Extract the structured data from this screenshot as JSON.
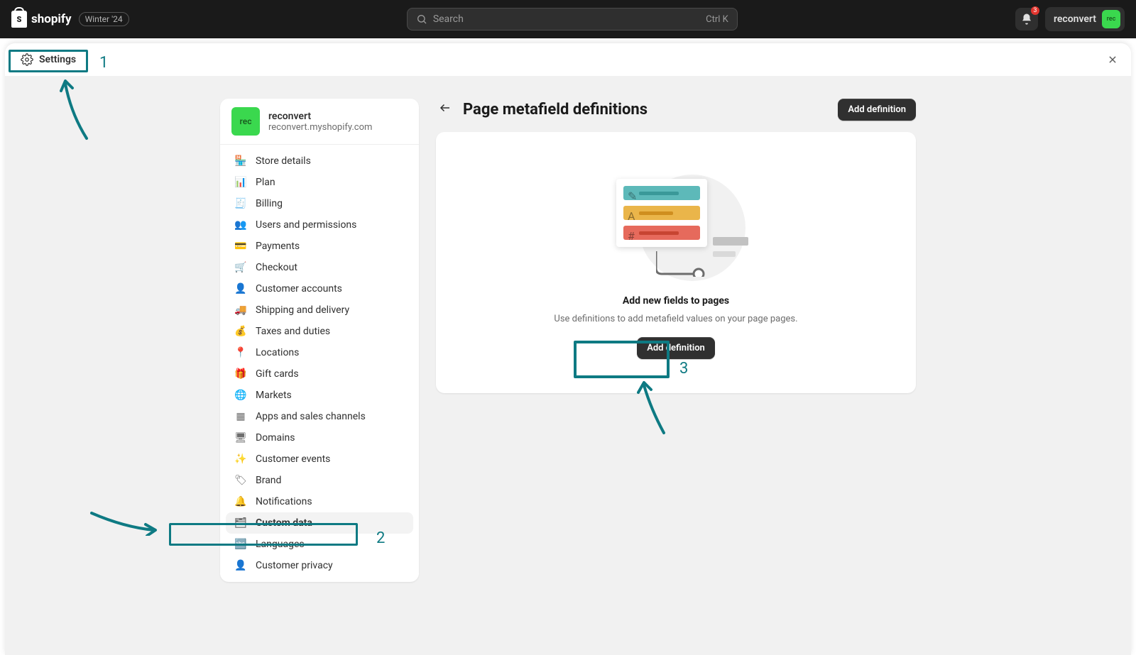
{
  "topbar": {
    "brand": "shopify",
    "badge": "Winter '24",
    "search_placeholder": "Search",
    "search_shortcut": "Ctrl K",
    "notif_count": "3",
    "user_name": "reconvert",
    "user_avatar_label": "rec"
  },
  "modal": {
    "crumb_label": "Settings"
  },
  "store": {
    "name": "reconvert",
    "url": "reconvert.myshopify.com",
    "avatar_label": "rec"
  },
  "sidebar": {
    "items": [
      {
        "label": "Store details",
        "icon": "🏪"
      },
      {
        "label": "Plan",
        "icon": "📊"
      },
      {
        "label": "Billing",
        "icon": "🧾"
      },
      {
        "label": "Users and permissions",
        "icon": "👥"
      },
      {
        "label": "Payments",
        "icon": "💳"
      },
      {
        "label": "Checkout",
        "icon": "🛒"
      },
      {
        "label": "Customer accounts",
        "icon": "👤"
      },
      {
        "label": "Shipping and delivery",
        "icon": "🚚"
      },
      {
        "label": "Taxes and duties",
        "icon": "💰"
      },
      {
        "label": "Locations",
        "icon": "📍"
      },
      {
        "label": "Gift cards",
        "icon": "🎁"
      },
      {
        "label": "Markets",
        "icon": "🌐"
      },
      {
        "label": "Apps and sales channels",
        "icon": "▦"
      },
      {
        "label": "Domains",
        "icon": "🖥"
      },
      {
        "label": "Customer events",
        "icon": "✨"
      },
      {
        "label": "Brand",
        "icon": "🏷"
      },
      {
        "label": "Notifications",
        "icon": "🔔"
      },
      {
        "label": "Custom data",
        "icon": "🗂"
      },
      {
        "label": "Languages",
        "icon": "🔤"
      },
      {
        "label": "Customer privacy",
        "icon": "👤"
      }
    ]
  },
  "main": {
    "title": "Page metafield definitions",
    "add_button": "Add definition",
    "empty_title": "Add new fields to pages",
    "empty_desc": "Use definitions to add metafield values on your page pages."
  },
  "annotations": {
    "n1": "1",
    "n2": "2",
    "n3": "3"
  }
}
